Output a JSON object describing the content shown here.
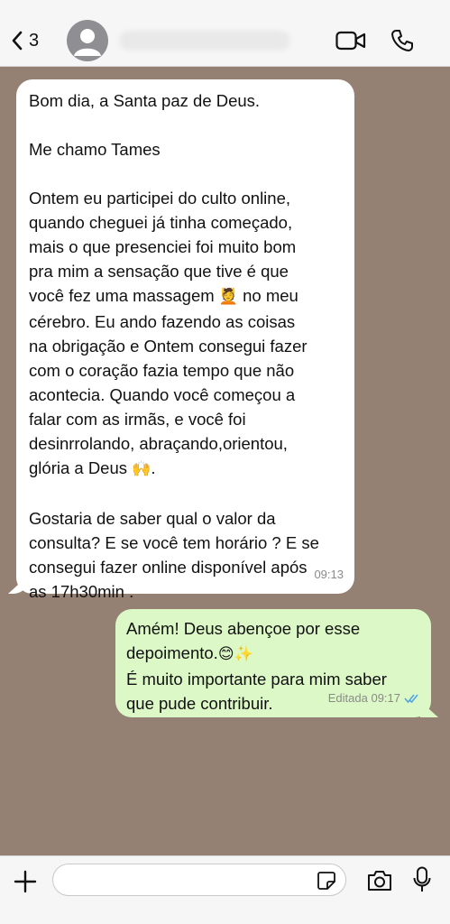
{
  "header": {
    "back_count": "3",
    "icons": [
      "chevron-left-icon",
      "avatar-icon",
      "video-camera-icon",
      "phone-icon"
    ]
  },
  "messages": {
    "incoming": {
      "paragraphs": [
        "Bom dia, a Santa paz de Deus.",
        "Me chamo Tames",
        "Ontem eu participei do culto online,\nquando cheguei já tinha começado,\nmais o que presenciei foi muito bom\npra mim a sensação que tive é que\nvocê fez uma massagem",
        "no meu\ncérebro. Eu ando fazendo as coisas\nna obrigação e Ontem consegui fazer\ncom o coração fazia tempo que não\nacontecia. Quando você começou a\nfalar com as irmãs, e você foi\ndesinrrolando, abraçando,orientou,\nglória a Deus",
        "Gostaria de saber qual o valor da\nconsulta? E se você tem horário ? E se\nconsegui fazer online disponível após\nas 17h30min ."
      ],
      "emoji_massage": "💆",
      "emoji_praise": "🙌",
      "time": "09:13"
    },
    "outgoing": {
      "line1": "Amém! Deus abençoe por esse\ndepoimento.",
      "emoji": "😊✨",
      "line2": "É muito importante para mim saber\nque pude contribuir.",
      "time": "Editada 09:17",
      "tick_color": "#4fa3e6"
    }
  },
  "composer": {
    "placeholder": "",
    "icons": [
      "plus-icon",
      "sticker-icon",
      "camera-icon",
      "microphone-icon"
    ]
  },
  "colors": {
    "background": "#958174",
    "incoming_bubble": "#ffffff",
    "outgoing_bubble": "#dcf8c6"
  }
}
